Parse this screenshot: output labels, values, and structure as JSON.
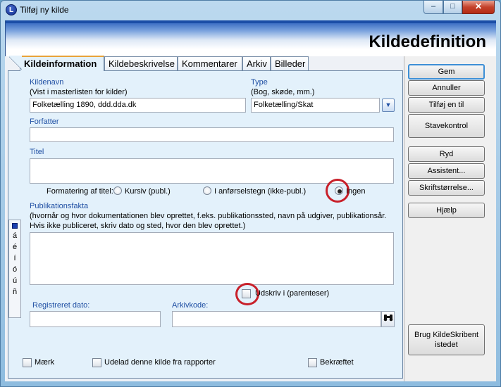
{
  "window": {
    "title": "Tilføj ny kilde",
    "icon_letter": "L",
    "minimize": "‒",
    "maximize": "□",
    "close": "✕"
  },
  "header": {
    "title": "Kildedefinition"
  },
  "tabs": [
    {
      "label": "Kildeinformation"
    },
    {
      "label": "Kildebeskrivelse"
    },
    {
      "label": "Kommentarer"
    },
    {
      "label": "Arkiv"
    },
    {
      "label": "Billeder"
    }
  ],
  "form": {
    "kildenavn_label": "Kildenavn",
    "kildenavn_hint": "(Vist i masterlisten for kilder)",
    "kildenavn_value": "Folketælling 1890, ddd.dda.dk",
    "type_label": "Type",
    "type_hint": "(Bog, skøde, mm.)",
    "type_value": "Folketælling/Skat",
    "forfatter_label": "Forfatter",
    "forfatter_value": "",
    "titel_label": "Titel",
    "titel_value": "",
    "formatering_label": "Formatering af titel:",
    "format_options": [
      "Kursiv (publ.)",
      "I anførselstegn (ikke-publ.)",
      "Ingen"
    ],
    "pubfakta_label": "Publikationsfakta",
    "pubfakta_hint1": "(hvornår og hvor dokumentationen blev oprettet, f.eks. publikationssted, navn på udgiver, publikationsår.",
    "pubfakta_hint2": "Hvis ikke publiceret, skriv dato og sted, hvor den blev oprettet.)",
    "pubfakta_value": "",
    "udskriv_label": "Udskriv i (parenteser)",
    "regdato_label": "Registreret dato:",
    "regdato_value": "",
    "arkivkode_label": "Arkivkode:",
    "arkivkode_value": "",
    "search_icon": "binoculars-icon",
    "maerk_label": "Mærk",
    "udelad_label": "Udelad denne kilde fra rapporter",
    "bekraeftet_label": "Bekræftet"
  },
  "special_chars": [
    "á",
    "é",
    "í",
    "ó",
    "ú",
    "ñ"
  ],
  "buttons": {
    "gem": "Gem",
    "annuller": "Annuller",
    "tilfoj": "Tilføj en til",
    "stavekontrol": "Stavekontrol",
    "ryd": "Ryd",
    "assistent": "Assistent...",
    "skrift": "Skriftstørrelse...",
    "hjaelp": "Hjælp",
    "brug_line1": "Brug KildeSkribent",
    "brug_line2": "istedet"
  },
  "colors": {
    "accent": "#1f4fa3",
    "highlight_ring": "#c8202a",
    "tab_active_top": "#e8a33b"
  }
}
